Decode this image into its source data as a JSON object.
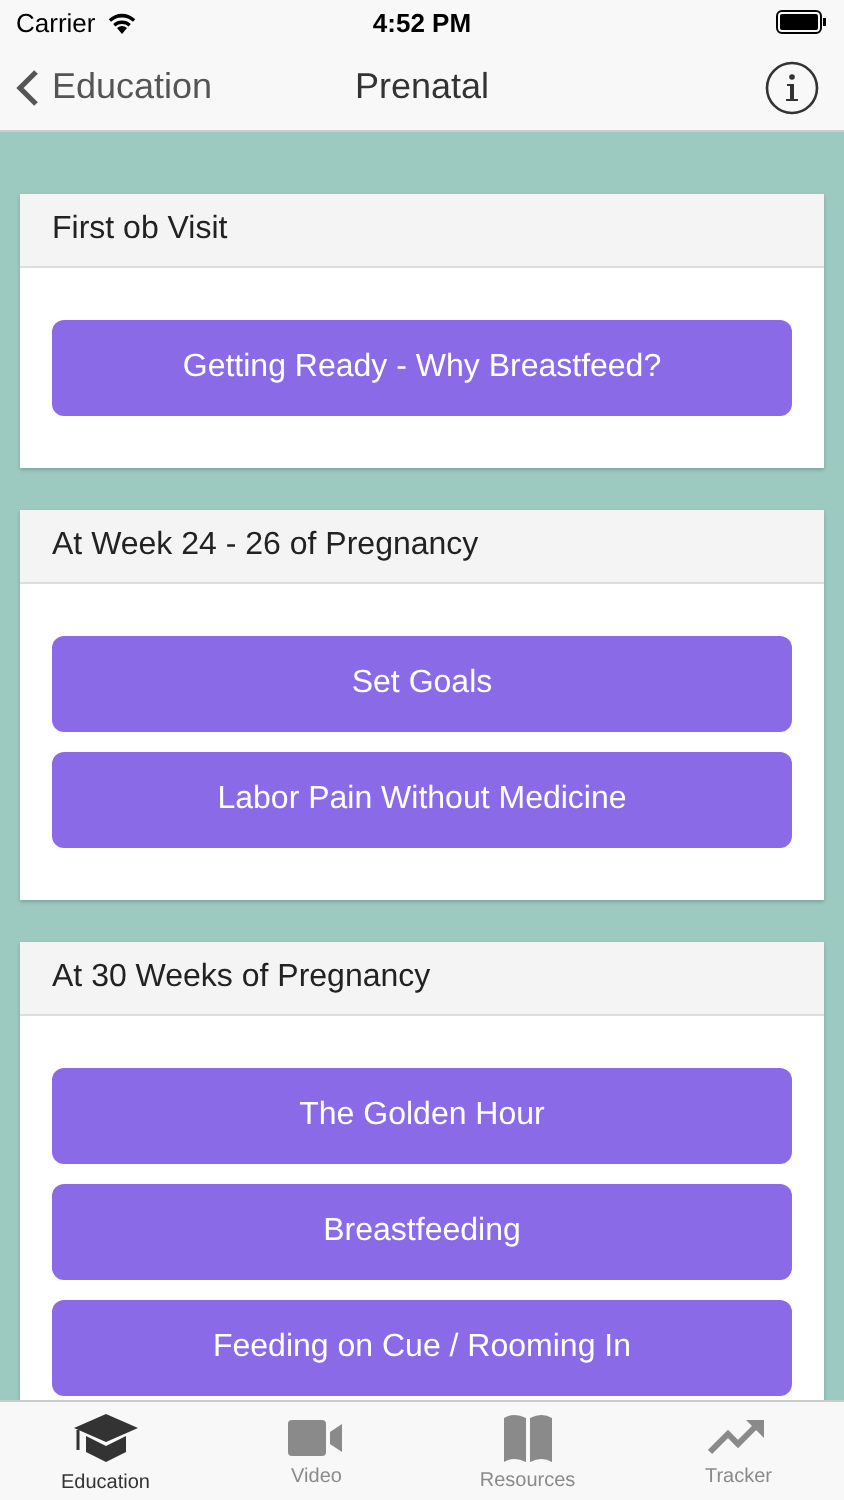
{
  "status_bar": {
    "carrier": "Carrier",
    "time": "4:52 PM"
  },
  "nav_bar": {
    "back": "Education",
    "title": "Prenatal"
  },
  "sections": [
    {
      "title": "First ob Visit",
      "buttons": [
        "Getting Ready - Why Breastfeed?"
      ]
    },
    {
      "title": "At Week 24 - 26 of Pregnancy",
      "buttons": [
        "Set Goals",
        "Labor Pain Without Medicine"
      ]
    },
    {
      "title": "At 30 Weeks of Pregnancy",
      "buttons": [
        "The Golden Hour",
        "Breastfeeding",
        "Feeding on Cue / Rooming In"
      ]
    }
  ],
  "tabs": [
    {
      "label": "Education",
      "kind": "education",
      "selected": true
    },
    {
      "label": "Video",
      "kind": "video",
      "selected": false
    },
    {
      "label": "Resources",
      "kind": "resources",
      "selected": false
    },
    {
      "label": "Tracker",
      "kind": "tracker",
      "selected": false
    }
  ]
}
